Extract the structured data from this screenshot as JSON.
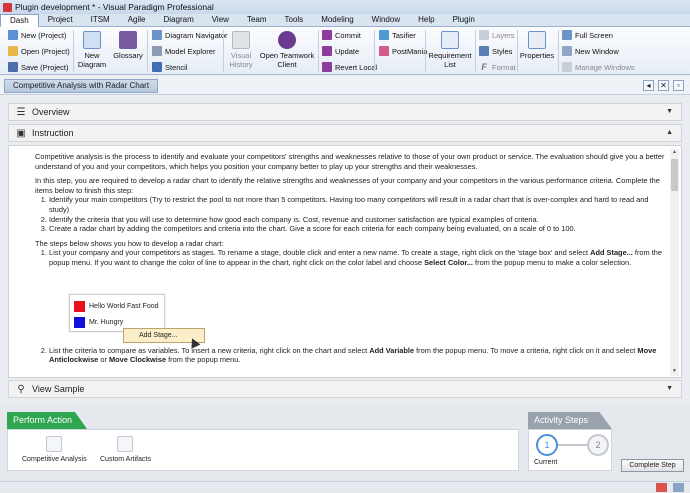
{
  "window": {
    "title": "Plugin development * - Visual Paradigm Professional"
  },
  "menu": [
    "Dash",
    "Project",
    "ITSM",
    "Agile",
    "Diagram",
    "View",
    "Team",
    "Tools",
    "Modeling",
    "Window",
    "Help",
    "Plugin"
  ],
  "ribbon": {
    "new_project": "New (Project)",
    "open_project": "Open (Project)",
    "save_project": "Save (Project)",
    "new_diagram": "New Diagram",
    "glossary": "Glossary",
    "diagram_navigator": "Diagram Navigator",
    "model_explorer": "Model Explorer",
    "stencil": "Stencil",
    "visual_history": "Visual History",
    "open_teamwork": "Open Teamwork Client",
    "commit": "Commit",
    "update": "Update",
    "revert_local": "Revert Local",
    "tasifier": "Tasifier",
    "postmania": "PostMania",
    "requirement_list": "Requirement List",
    "layers": "Layers",
    "styles": "Styles",
    "format": "Format",
    "properties": "Properties",
    "full_screen": "Full Screen",
    "new_window": "New Window",
    "manage_windows": "Manage Windows"
  },
  "breadcrumb": {
    "tab": "Competitive Analysis with Radar Chart"
  },
  "sections": {
    "overview": "Overview",
    "instruction": "Instruction",
    "view_sample": "View Sample"
  },
  "instruction": {
    "intro": "Competitive analysis is the process to identify and evaluate your competitors' strengths and weaknesses relative to those of your own product or service. The evaluation should give you a better understand of you and your competitors, which helps you position your company better to play up your strengths and their weaknesses.",
    "step_intro": "In this step, you are required to develop a radar chart to identify the relative strengths and weaknesses of your company and your competitors in the various performance criteria. Complete the items below to finish this step:",
    "items": [
      "Identify your main competitors (Try to restrict the pool to not more than 5 competitors. Having too many competitors will result in a radar chart that is over-complex and hard to read and study)",
      "Identify the criteria that you will use to determine how good each company is. Cost, revenue and customer satisfaction are typical examples of criteria.",
      "Create a radar chart by adding the competitors and criteria into the chart. Give a score for each criteria for each company being evaluated, on a scale of 0 to 100."
    ],
    "steps_heading": "The steps below shows you how to develop a radar chart:",
    "step1_a": "List your company and your competitors as stages. To rename a stage, double click and enter a new name. To create a stage, right click on the 'stage box' and select ",
    "step1_b1": "Add Stage...",
    "step1_c": " from the popup menu. If you want to change the color of line to appear in the chart, right click on the color label and choose ",
    "step1_b2": "Select Color...",
    "step1_d": " from the popup menu to make a color selection.",
    "demo_stages": [
      {
        "name": "Hello World Fast Food",
        "color": "#e8101e"
      },
      {
        "name": "Mr. Hungry",
        "color": "#1010d8"
      }
    ],
    "context_menu": "Add Stage...",
    "step2_a": "List the criteria to compare as variables. To insert a new criteria, right click on the chart and select ",
    "step2_b1": "Add Variable",
    "step2_c": " from the popup menu. To move a criteria, right click on it and select ",
    "step2_b2": "Move Anticlockwise",
    "step2_d": " or ",
    "step2_b3": "Move Clockwise",
    "step2_e": " from the popup menu."
  },
  "perform_action": {
    "title": "Perform Action",
    "items": [
      "Competitive Analysis",
      "Custom Artifacts"
    ]
  },
  "activity_steps": {
    "title": "Activity Steps",
    "steps": [
      "1",
      "2"
    ],
    "current_label": "Current",
    "complete_button": "Complete Step"
  }
}
